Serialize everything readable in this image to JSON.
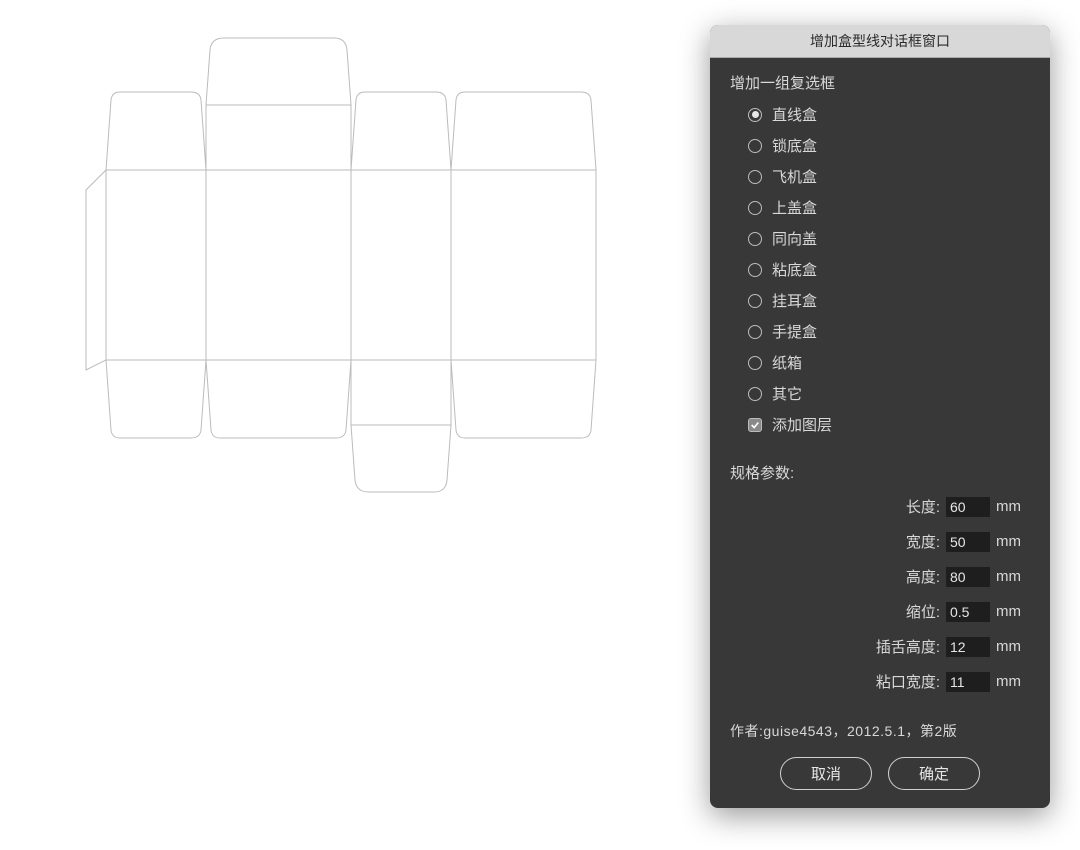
{
  "dialog": {
    "title": "增加盒型线对话框窗口",
    "group_label": "增加一组复选框",
    "box_types": [
      {
        "label": "直线盒",
        "selected": true
      },
      {
        "label": "锁底盒",
        "selected": false
      },
      {
        "label": "飞机盒",
        "selected": false
      },
      {
        "label": "上盖盒",
        "selected": false
      },
      {
        "label": "同向盖",
        "selected": false
      },
      {
        "label": "粘底盒",
        "selected": false
      },
      {
        "label": "挂耳盒",
        "selected": false
      },
      {
        "label": "手提盒",
        "selected": false
      },
      {
        "label": "纸箱",
        "selected": false
      },
      {
        "label": "其它",
        "selected": false
      }
    ],
    "add_layer_label": "添加图层",
    "add_layer_checked": true,
    "params_label": "规格参数:",
    "params": [
      {
        "label": "长度:",
        "value": "60",
        "unit": "mm"
      },
      {
        "label": "宽度:",
        "value": "50",
        "unit": "mm"
      },
      {
        "label": "高度:",
        "value": "80",
        "unit": "mm"
      },
      {
        "label": "缩位:",
        "value": "0.5",
        "unit": "mm"
      },
      {
        "label": "插舌高度:",
        "value": "12",
        "unit": "mm"
      },
      {
        "label": "粘口宽度:",
        "value": "11",
        "unit": "mm"
      }
    ],
    "author_line": "作者:guise4543，2012.5.1，第2版",
    "cancel_label": "取消",
    "ok_label": "确定"
  }
}
